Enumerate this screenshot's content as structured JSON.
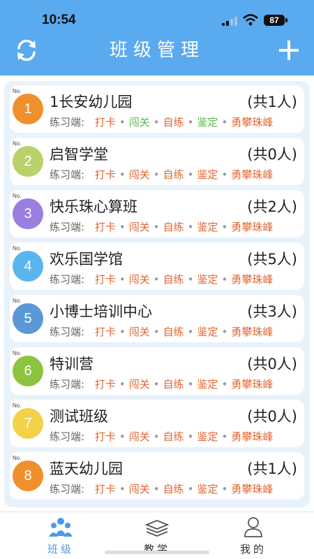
{
  "status": {
    "time": "10:54",
    "battery": "87"
  },
  "header": {
    "title": "班级管理",
    "refresh_icon": "refresh-icon",
    "add_icon": "plus-icon"
  },
  "classes": [
    {
      "no_label": "No.",
      "num": "1",
      "name": "1长安幼儿园",
      "count": "(共1人)",
      "color": "#f0902c",
      "done": [
        1,
        3
      ]
    },
    {
      "no_label": "No.",
      "num": "2",
      "name": "启智学堂",
      "count": "(共0人)",
      "color": "#b9d26a",
      "done": []
    },
    {
      "no_label": "No.",
      "num": "3",
      "name": "快乐珠心算班",
      "count": "(共2人)",
      "color": "#9a7ee0",
      "done": []
    },
    {
      "no_label": "No.",
      "num": "4",
      "name": "欢乐国学馆",
      "count": "(共5人)",
      "color": "#5ab5ef",
      "done": []
    },
    {
      "no_label": "No.",
      "num": "5",
      "name": "小博士培训中心",
      "count": "(共3人)",
      "color": "#5b98d6",
      "done": []
    },
    {
      "no_label": "No.",
      "num": "6",
      "name": "特训营",
      "count": "(共0人)",
      "color": "#8cc43f",
      "done": []
    },
    {
      "no_label": "No.",
      "num": "7",
      "name": "测试班级",
      "count": "(共0人)",
      "color": "#f2d24a",
      "done": []
    },
    {
      "no_label": "No.",
      "num": "8",
      "name": "蓝天幼儿园",
      "count": "(共1人)",
      "color": "#f0902c",
      "done": []
    }
  ],
  "links": {
    "label": "练习端:",
    "items": [
      "打卡",
      "闯关",
      "自练",
      "鉴定",
      "勇攀珠峰"
    ]
  },
  "tabs": [
    {
      "label": "班级",
      "icon": "class-people-icon",
      "active": true
    },
    {
      "label": "教学",
      "icon": "books-icon",
      "active": false
    },
    {
      "label": "我的",
      "icon": "user-icon",
      "active": false
    }
  ],
  "colors": {
    "primary": "#5aaaf0",
    "link": "#e06633",
    "done": "#5cb85c"
  }
}
